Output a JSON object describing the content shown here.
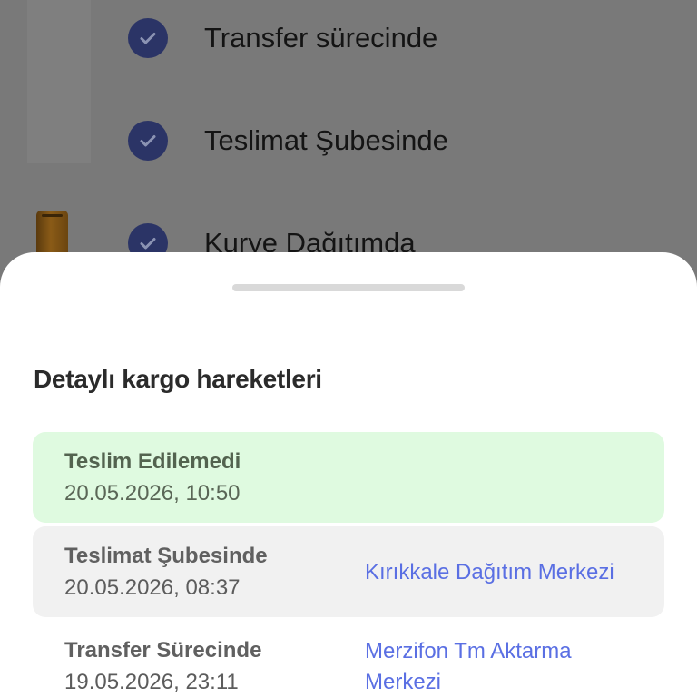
{
  "background_timeline": {
    "steps": [
      {
        "label": "Transfer sürecinde",
        "icon": "check-circle-icon"
      },
      {
        "label": "Teslimat Şubesinde",
        "icon": "check-circle-icon"
      },
      {
        "label": "Kurye Dağıtımda",
        "icon": "check-circle-icon"
      }
    ],
    "check_color": "#2b3466"
  },
  "sheet": {
    "title": "Detaylı kargo hareketleri",
    "movements": [
      {
        "status": "Teslim Edilemedi",
        "datetime": "20.05.2026, 10:50",
        "location": "",
        "highlight": "#dffae0"
      },
      {
        "status": "Teslimat Şubesinde",
        "datetime": "20.05.2026, 08:37",
        "location": "Kırıkkale Dağıtım Merkezi"
      },
      {
        "status": "Transfer Sürecinde",
        "datetime": "19.05.2026, 23:11",
        "location": "Merzifon Tm Aktarma Merkezi"
      }
    ],
    "link_color": "#5a6fe3"
  }
}
